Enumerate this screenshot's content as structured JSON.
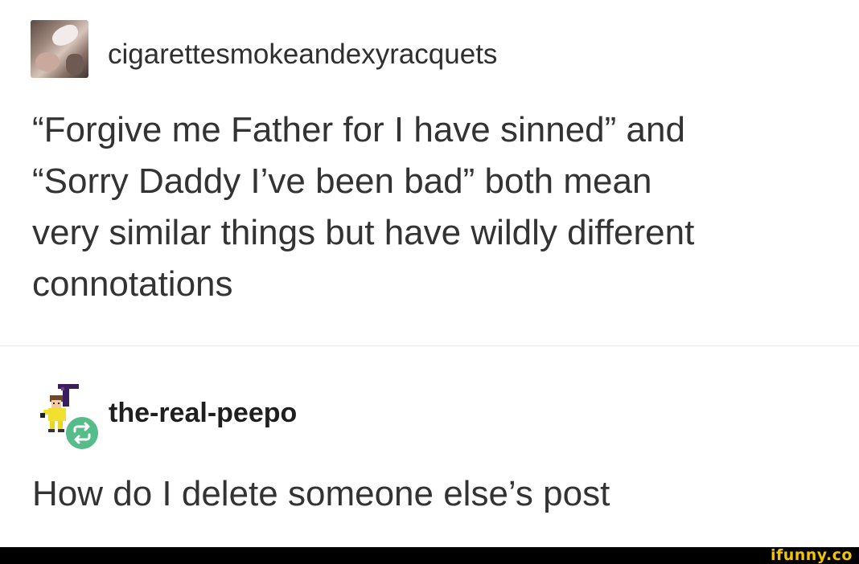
{
  "posts": [
    {
      "username": "cigarettesmokeandexyracquets",
      "body_lines": [
        "“Forgive me Father for I have sinned” and",
        "“Sorry Daddy I’ve been bad” both mean",
        "very similar things but have wildly different",
        "connotations"
      ]
    },
    {
      "username": "the-real-peepo",
      "body": "How do I delete someone else’s post",
      "badge_icon": "reblog-icon"
    }
  ],
  "footer": {
    "watermark": "ifunny.co"
  },
  "colors": {
    "reblog_badge": "#56bc8a",
    "watermark": "#f2c400",
    "divider": "#e6e6e6"
  }
}
